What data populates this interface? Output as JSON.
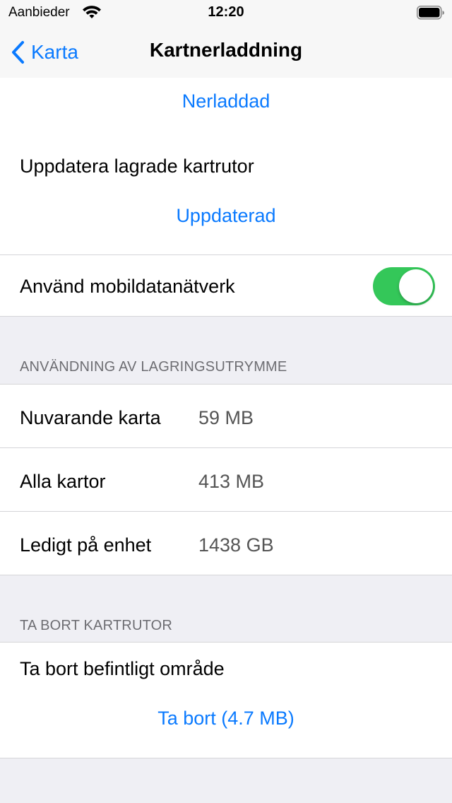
{
  "status_bar": {
    "carrier": "Aanbieder",
    "time": "12:20"
  },
  "nav": {
    "back_label": "Karta",
    "title": "Kartnerladdning"
  },
  "download": {
    "status_link": "Nerladdad"
  },
  "update": {
    "label": "Uppdatera lagrade kartrutor",
    "status_link": "Uppdaterad"
  },
  "mobile_data": {
    "label": "Använd mobildatanätverk",
    "enabled": true
  },
  "storage": {
    "header": "ANVÄNDNING AV LAGRINGSUTRYMME",
    "rows": [
      {
        "label": "Nuvarande karta",
        "value": "59 MB"
      },
      {
        "label": "Alla kartor",
        "value": "413 MB"
      },
      {
        "label": "Ledigt på enhet",
        "value": "1438 GB"
      }
    ]
  },
  "delete": {
    "header": "TA BORT KARTRUTOR",
    "label": "Ta bort befintligt område",
    "action_link": "Ta bort (4.7 MB)"
  },
  "colors": {
    "accent": "#0a7aff",
    "toggle_on": "#34c759",
    "background": "#efeff4"
  }
}
